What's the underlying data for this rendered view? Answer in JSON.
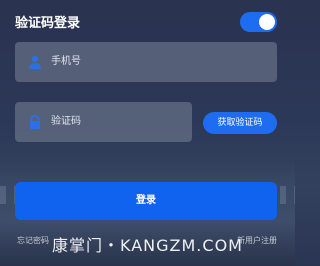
{
  "header": {
    "title": "验证码登录",
    "toggle_on": true
  },
  "colors": {
    "accent": "#1e6cf0",
    "field_bg": "#7a8296",
    "background": "#2c3858"
  },
  "phone": {
    "placeholder": "手机号",
    "icon": "user-icon"
  },
  "code": {
    "placeholder": "验证码",
    "icon": "lock-icon",
    "get_code_label": "获取验证码"
  },
  "login_label": "登录",
  "footer": {
    "forgot": "忘记密码",
    "register": "新用户注册"
  },
  "watermark": "康掌门・KANGZM.COM"
}
